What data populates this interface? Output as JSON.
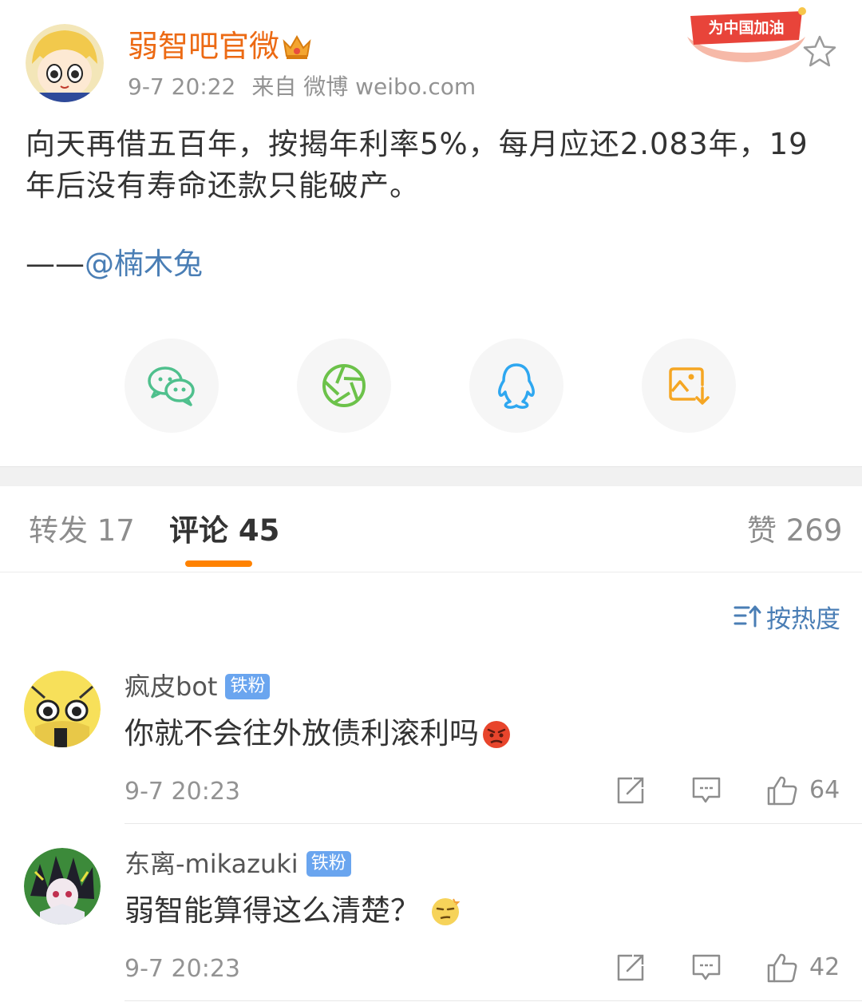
{
  "post": {
    "author": "弱智吧官微",
    "time": "9-7 20:22",
    "source": "来自 微博 weibo.com",
    "banner_text": "为中国加油",
    "text": "向天再借五百年，按揭年利率5%，每月应还2.083年，19年后没有寿命还款只能破产。",
    "mention_prefix": "——",
    "mention": "@楠木兔"
  },
  "share": [
    {
      "name": "wechat-share-icon",
      "color": "#4fc08d"
    },
    {
      "name": "moments-share-icon",
      "color": "#6cc24a"
    },
    {
      "name": "qq-share-icon",
      "color": "#2ea7f0"
    },
    {
      "name": "save-image-icon",
      "color": "#f5a623"
    }
  ],
  "tabs": {
    "repost": "转发 17",
    "comments": "评论 45",
    "likes": "赞 269"
  },
  "sort_label": "按热度",
  "comments": [
    {
      "name": "疯皮bot",
      "badge": "铁粉",
      "text": "你就不会往外放债利滚利吗",
      "time": "9-7 20:23",
      "likes": "64"
    },
    {
      "name": "东离-mikazuki",
      "badge": "铁粉",
      "text": "弱智能算得这么清楚？",
      "time": "9-7 20:23",
      "likes": "42"
    }
  ],
  "colors": {
    "accent": "#ff8200",
    "author": "#ec6a14",
    "link": "#4a7eb5",
    "badge": "#6aa5ef"
  }
}
